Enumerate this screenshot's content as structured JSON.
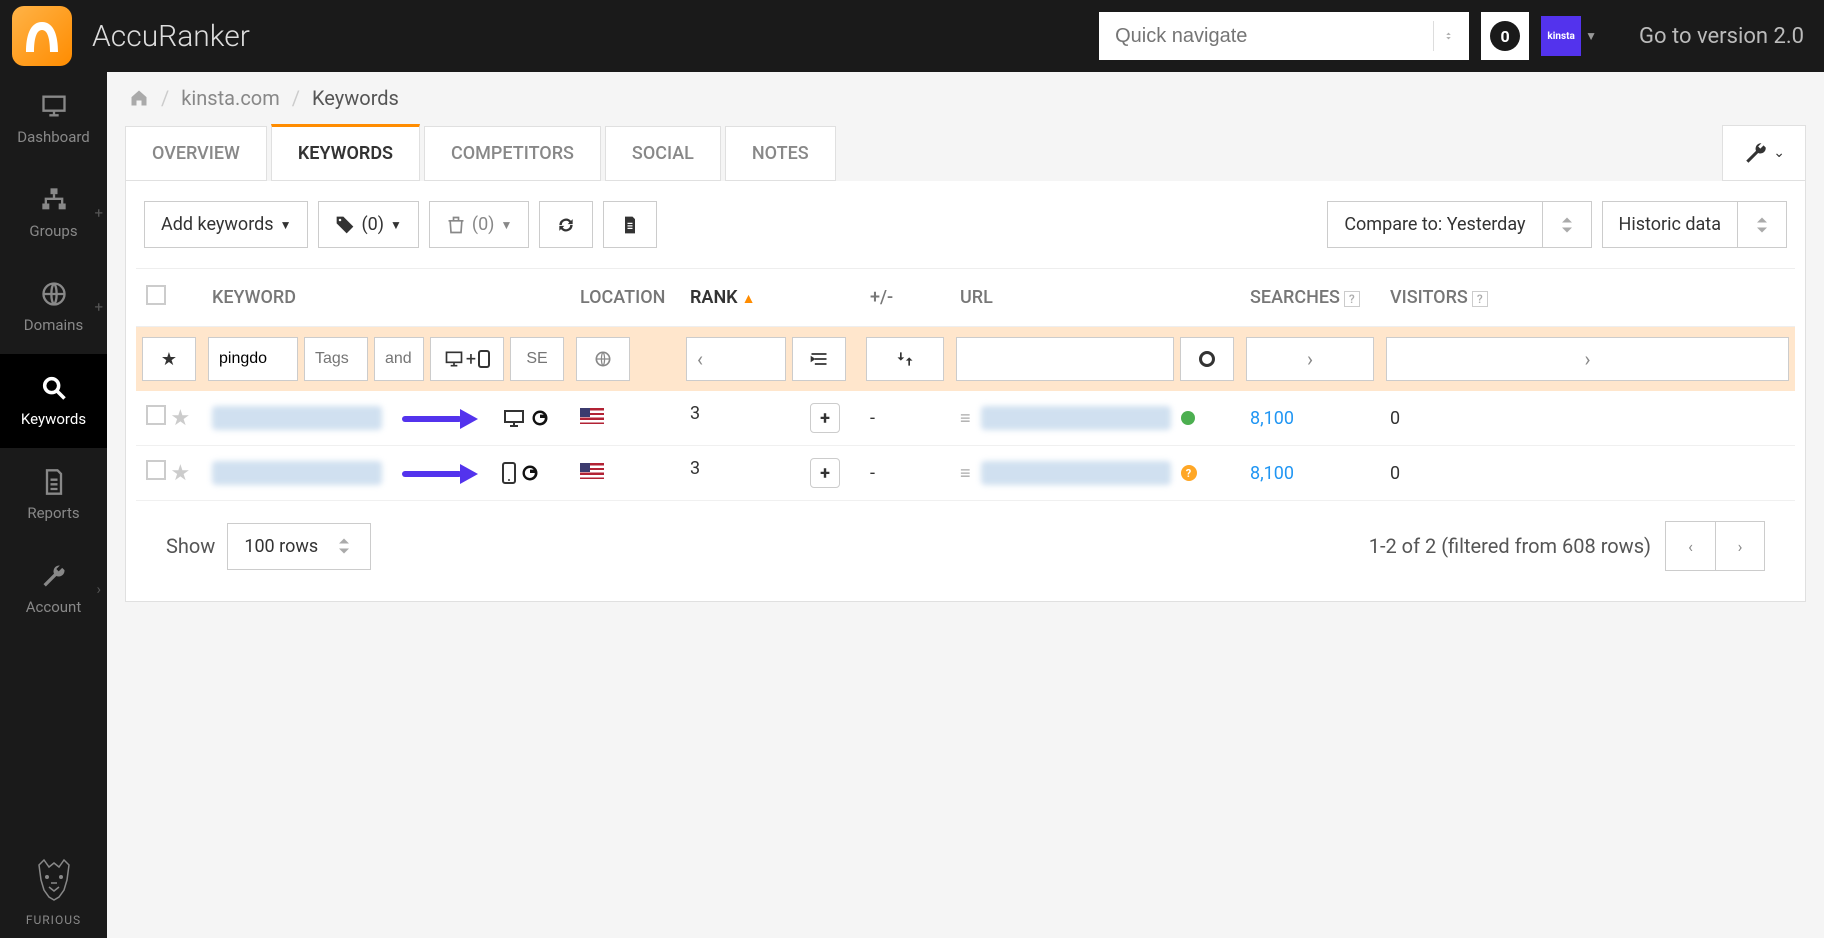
{
  "header": {
    "brand": "AccuRanker",
    "quick_nav_placeholder": "Quick navigate",
    "notification_count": "0",
    "workspace": "kinsta",
    "version_link": "Go to version 2.0"
  },
  "sidebar": {
    "items": [
      {
        "label": "Dashboard"
      },
      {
        "label": "Groups"
      },
      {
        "label": "Domains"
      },
      {
        "label": "Keywords"
      },
      {
        "label": "Reports"
      },
      {
        "label": "Account"
      }
    ],
    "furious_label": "FURIOUS"
  },
  "breadcrumb": {
    "domain": "kinsta.com",
    "page": "Keywords"
  },
  "tabs": [
    {
      "label": "OVERVIEW"
    },
    {
      "label": "KEYWORDS"
    },
    {
      "label": "COMPETITORS"
    },
    {
      "label": "SOCIAL"
    },
    {
      "label": "NOTES"
    }
  ],
  "toolbar": {
    "add_keywords": "Add keywords",
    "tag_count": "(0)",
    "trash_count": "(0)",
    "compare_to": "Compare to: Yesterday",
    "historic": "Historic data"
  },
  "columns": {
    "keyword": "KEYWORD",
    "location": "LOCATION",
    "rank": "RANK",
    "plusminus": "+/-",
    "url": "URL",
    "searches": "SEARCHES",
    "visitors": "VISITORS"
  },
  "filters": {
    "keyword_value": "pingdo",
    "tags_placeholder": "Tags",
    "and_placeholder": "and",
    "se_placeholder": "SE"
  },
  "rows": [
    {
      "rank": "3",
      "change": "-",
      "searches": "8,100",
      "visitors": "0",
      "device": "desktop",
      "status": "green"
    },
    {
      "rank": "3",
      "change": "-",
      "searches": "8,100",
      "visitors": "0",
      "device": "mobile",
      "status": "orange"
    }
  ],
  "footer": {
    "show_label": "Show",
    "rows_value": "100 rows",
    "info": "1-2 of 2 (filtered from 608 rows)"
  }
}
